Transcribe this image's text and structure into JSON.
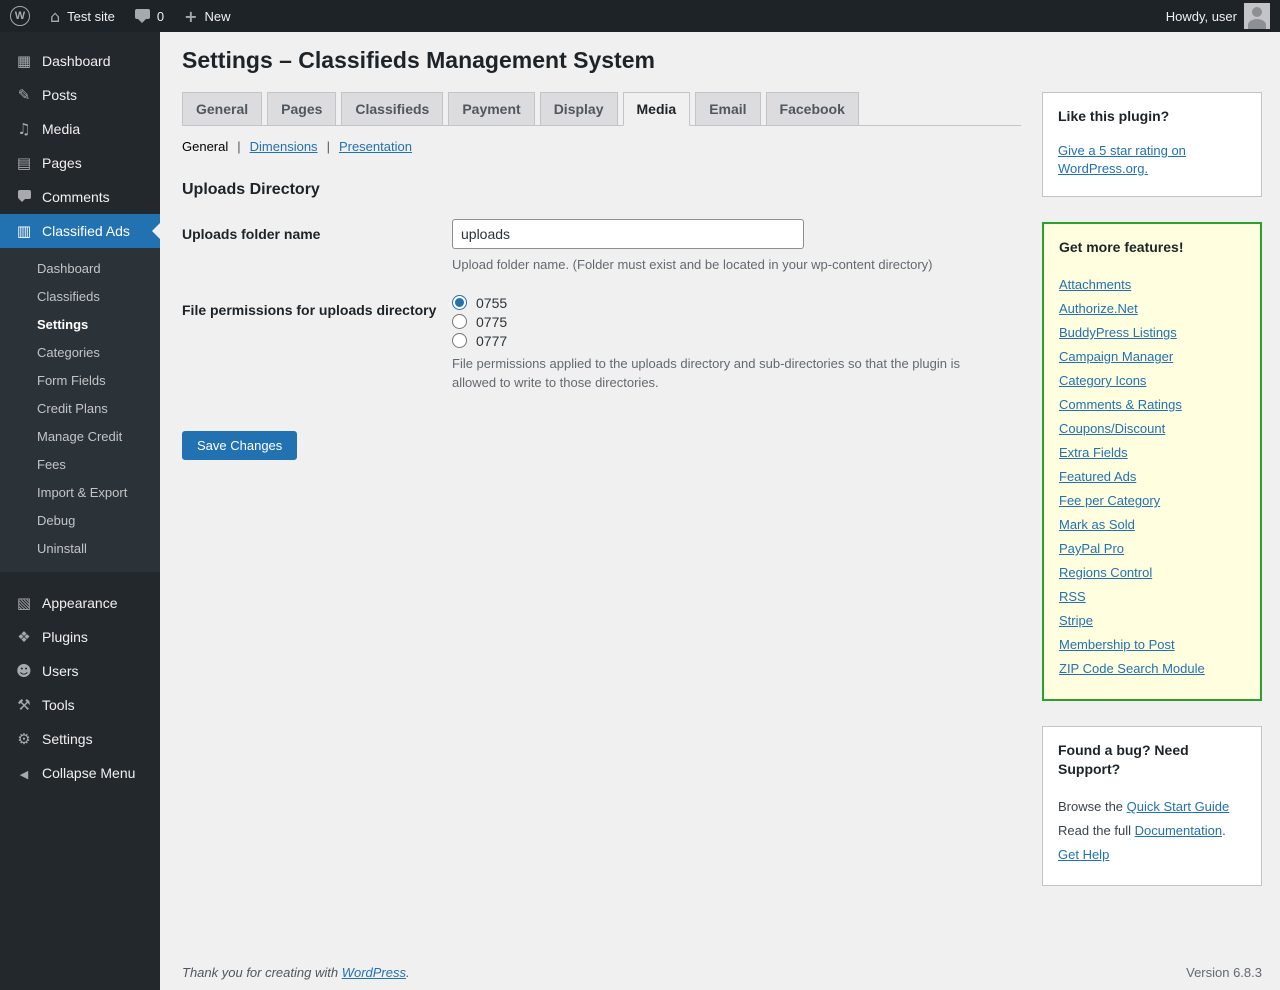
{
  "admin_bar": {
    "site_name": "Test site",
    "comments_count": "0",
    "new_label": "New",
    "howdy_text": "Howdy, user"
  },
  "sidebar": {
    "items_top": [
      {
        "label": "Dashboard",
        "icon": "dashboard-icon",
        "active": false
      },
      {
        "label": "Posts",
        "icon": "posts-icon",
        "active": false
      },
      {
        "label": "Media",
        "icon": "media-icon",
        "active": false
      },
      {
        "label": "Pages",
        "icon": "pages-icon",
        "active": false
      },
      {
        "label": "Comments",
        "icon": "comments-icon",
        "active": false
      },
      {
        "label": "Classified Ads",
        "icon": "classified-ads-icon",
        "active": true
      }
    ],
    "submenu_items": [
      {
        "label": "Dashboard",
        "active": false
      },
      {
        "label": "Classifieds",
        "active": false
      },
      {
        "label": "Settings",
        "active": true
      },
      {
        "label": "Categories",
        "active": false
      },
      {
        "label": "Form Fields",
        "active": false
      },
      {
        "label": "Credit Plans",
        "active": false
      },
      {
        "label": "Manage Credit",
        "active": false
      },
      {
        "label": "Fees",
        "active": false
      },
      {
        "label": "Import & Export",
        "active": false
      },
      {
        "label": "Debug",
        "active": false
      },
      {
        "label": "Uninstall",
        "active": false
      }
    ],
    "items_bottom": [
      {
        "label": "Appearance",
        "icon": "appearance-icon",
        "active": false
      },
      {
        "label": "Plugins",
        "icon": "plugins-icon",
        "active": false
      },
      {
        "label": "Users",
        "icon": "users-icon",
        "active": false
      },
      {
        "label": "Tools",
        "icon": "tools-icon",
        "active": false
      },
      {
        "label": "Settings",
        "icon": "settings-icon",
        "active": false
      },
      {
        "label": "Collapse Menu",
        "icon": "collapse-icon",
        "active": false
      }
    ]
  },
  "main": {
    "page_title": "Settings – Classifieds Management System",
    "tabs": [
      {
        "label": "General",
        "active": false
      },
      {
        "label": "Pages",
        "active": false
      },
      {
        "label": "Classifieds",
        "active": false
      },
      {
        "label": "Payment",
        "active": false
      },
      {
        "label": "Display",
        "active": false
      },
      {
        "label": "Media",
        "active": true
      },
      {
        "label": "Email",
        "active": false
      },
      {
        "label": "Facebook",
        "active": false
      }
    ],
    "subnav": [
      {
        "label": "General",
        "current": true
      },
      {
        "label": "Dimensions",
        "current": false
      },
      {
        "label": "Presentation",
        "current": false
      }
    ],
    "section_title": "Uploads Directory",
    "form": {
      "folder_label": "Uploads folder name",
      "folder_value": "uploads",
      "folder_help": "Upload folder name. (Folder must exist and be located in your wp-content directory)",
      "perm_label": "File permissions for uploads directory",
      "perm_options": [
        {
          "label": "0755",
          "checked": true
        },
        {
          "label": "0775",
          "checked": false
        },
        {
          "label": "0777",
          "checked": false
        }
      ],
      "perm_help": "File permissions applied to the uploads directory and sub-directories so that the plugin is allowed to write to those directories.",
      "save_label": "Save Changes"
    }
  },
  "widgets": {
    "rating": {
      "title": "Like this plugin?",
      "link": "Give a 5 star rating on WordPress.org."
    },
    "features": {
      "title": "Get more features!",
      "links": [
        "Attachments",
        "Authorize.Net",
        "BuddyPress Listings",
        "Campaign Manager",
        "Category Icons",
        "Comments & Ratings",
        "Coupons/Discount",
        "Extra Fields",
        "Featured Ads",
        "Fee per Category",
        "Mark as Sold",
        "PayPal Pro",
        "Regions Control",
        "RSS",
        "Stripe",
        "Membership to Post",
        "ZIP Code Search Module"
      ]
    },
    "support": {
      "title": "Found a bug? Need Support?",
      "browse_prefix": "Browse the ",
      "quick_start_link": "Quick Start Guide",
      "read_prefix": "Read the full ",
      "documentation_link": "Documentation",
      "read_suffix": ".",
      "get_help_link": "Get Help"
    }
  },
  "footer": {
    "thanks_prefix": "Thank you for creating with ",
    "wordpress_link": "WordPress",
    "thanks_suffix": ".",
    "version": "Version 6.8.3"
  },
  "colors": {
    "admin_bar_bg": "#1d2327",
    "sidebar_bg": "#23282d",
    "active_menu_blue": "#2271b1",
    "link_blue": "#2271b1",
    "save_button_blue": "#2271b1",
    "features_box_bg": "#ffffe0",
    "features_box_border": "#2ca02c",
    "content_bg": "#f0f0f1"
  }
}
